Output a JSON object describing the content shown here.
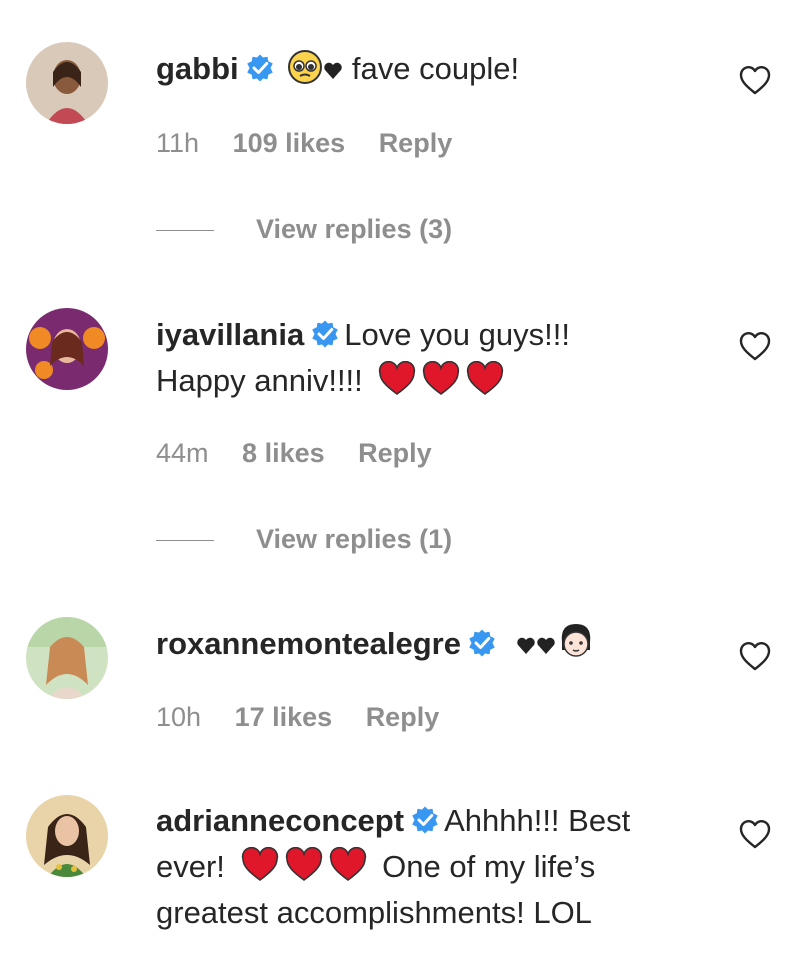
{
  "comments": [
    {
      "username": "gabbi",
      "text": " fave couple!",
      "time": "11h",
      "likes": "109 likes",
      "reply": "Reply",
      "view_replies": "View replies (3)"
    },
    {
      "username": "iyavillania",
      "text_line1": "Love you guys!!!",
      "text_line2": "Happy anniv!!!!",
      "time": "44m",
      "likes": "8 likes",
      "reply": "Reply",
      "view_replies": "View replies (1)"
    },
    {
      "username": "roxannemontealegre",
      "time": "10h",
      "likes": "17 likes",
      "reply": "Reply"
    },
    {
      "username": "adrianneconcept",
      "text_part1": "Ahhhh!!! Best",
      "text_part2": "ever!",
      "text_part3": "One of my life’s",
      "text_part4": "greatest accomplishments! LOL"
    }
  ],
  "colors": {
    "verified_blue": "#3897f0",
    "heart_red": "#e0162b",
    "meta_gray": "#8e8e8e"
  },
  "icons": {
    "verified": "verified-badge-icon",
    "like": "heart-outline-icon",
    "heart_emoji": "red-heart-emoji"
  }
}
